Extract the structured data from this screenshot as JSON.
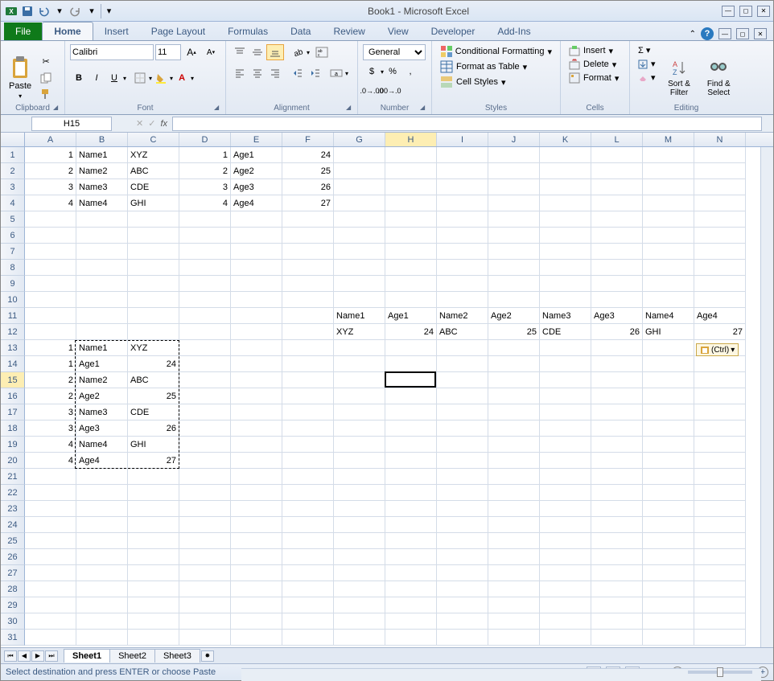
{
  "app": {
    "title": "Book1 - Microsoft Excel"
  },
  "qat": {
    "save": "save",
    "undo": "undo",
    "redo": "redo"
  },
  "tabs": {
    "file": "File",
    "home": "Home",
    "insert": "Insert",
    "pagelayout": "Page Layout",
    "formulas": "Formulas",
    "data": "Data",
    "review": "Review",
    "view": "View",
    "developer": "Developer",
    "addins": "Add-Ins"
  },
  "ribbon": {
    "clipboard": {
      "label": "Clipboard",
      "paste": "Paste"
    },
    "font": {
      "label": "Font",
      "name": "Calibri",
      "size": "11",
      "bold": "B",
      "italic": "I",
      "underline": "U"
    },
    "alignment": {
      "label": "Alignment",
      "wrap": "Wrap Text",
      "merge": "Merge & Center"
    },
    "number": {
      "label": "Number",
      "format": "General"
    },
    "styles": {
      "label": "Styles",
      "cond": "Conditional Formatting",
      "table": "Format as Table",
      "cell": "Cell Styles"
    },
    "cells": {
      "label": "Cells",
      "insert": "Insert",
      "delete": "Delete",
      "format": "Format"
    },
    "editing": {
      "label": "Editing",
      "sort": "Sort & Filter",
      "find": "Find & Select"
    }
  },
  "namebox": "H15",
  "fx": "fx",
  "columns": [
    "A",
    "B",
    "C",
    "D",
    "E",
    "F",
    "G",
    "H",
    "I",
    "J",
    "K",
    "L",
    "M",
    "N"
  ],
  "rows": 31,
  "cells": {
    "A1": "1",
    "B1": "Name1",
    "C1": "XYZ",
    "D1": "1",
    "E1": "Age1",
    "F1": "24",
    "A2": "2",
    "B2": "Name2",
    "C2": "ABC",
    "D2": "2",
    "E2": "Age2",
    "F2": "25",
    "A3": "3",
    "B3": "Name3",
    "C3": "CDE",
    "D3": "3",
    "E3": "Age3",
    "F3": "26",
    "A4": "4",
    "B4": "Name4",
    "C4": "GHI",
    "D4": "4",
    "E4": "Age4",
    "F4": "27",
    "G11": "Name1",
    "H11": "Age1",
    "I11": "Name2",
    "J11": "Age2",
    "K11": "Name3",
    "L11": "Age3",
    "M11": "Name4",
    "N11": "Age4",
    "G12": "XYZ",
    "H12": "24",
    "I12": "ABC",
    "J12": "25",
    "K12": "CDE",
    "L12": "26",
    "M12": "GHI",
    "N12": "27",
    "A13": "1",
    "B13": "Name1",
    "C13": "XYZ",
    "A14": "1",
    "B14": "Age1",
    "C14": "24",
    "A15": "2",
    "B15": "Name2",
    "C15": "ABC",
    "A16": "2",
    "B16": "Age2",
    "C16": "25",
    "A17": "3",
    "B17": "Name3",
    "C17": "CDE",
    "A18": "3",
    "B18": "Age3",
    "C18": "26",
    "A19": "4",
    "B19": "Name4",
    "C19": "GHI",
    "A20": "4",
    "B20": "Age4",
    "C20": "27"
  },
  "numeric_cells": [
    "A1",
    "A2",
    "A3",
    "A4",
    "D1",
    "D2",
    "D3",
    "D4",
    "F1",
    "F2",
    "F3",
    "F4",
    "A13",
    "A14",
    "A15",
    "A16",
    "A17",
    "A18",
    "A19",
    "A20",
    "C14",
    "C16",
    "C18",
    "C20",
    "H12",
    "J12",
    "L12",
    "N12"
  ],
  "selection": {
    "cell": "H15",
    "row": 15,
    "col": "H"
  },
  "marching": {
    "top_row": 13,
    "bottom_row": 20,
    "left_col": "A",
    "right_col": "C"
  },
  "paste_options": "(Ctrl)",
  "sheets": {
    "s1": "Sheet1",
    "s2": "Sheet2",
    "s3": "Sheet3"
  },
  "statusbar": {
    "msg": "Select destination and press ENTER or choose Paste",
    "zoom": "100%"
  }
}
